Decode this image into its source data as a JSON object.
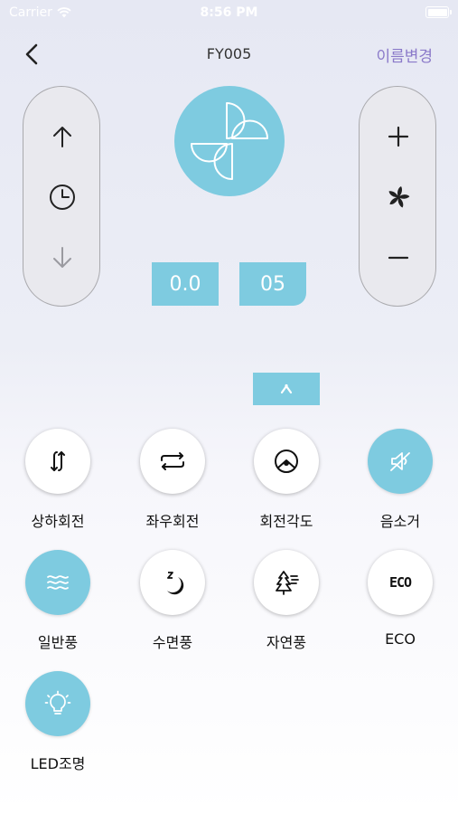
{
  "status_bar": {
    "carrier": "Carrier",
    "time": "8:56 PM"
  },
  "nav": {
    "title": "FY005",
    "rename_label": "이름변경"
  },
  "display": {
    "timer_value": "0.0",
    "speed_value": "05"
  },
  "colors": {
    "accent": "#7ecbe0",
    "rename": "#8a79c9"
  },
  "left_controls": [
    "arrow-up-icon",
    "timer-icon",
    "arrow-down-icon"
  ],
  "right_controls": [
    "plus-icon",
    "fan-icon",
    "minus-icon"
  ],
  "functions": [
    {
      "label": "상하회전",
      "icon": "vertical-swing-icon",
      "active": false
    },
    {
      "label": "좌우회전",
      "icon": "horizontal-swing-icon",
      "active": false
    },
    {
      "label": "회전각도",
      "icon": "rotation-angle-icon",
      "active": false
    },
    {
      "label": "음소거",
      "icon": "mute-icon",
      "active": true
    },
    {
      "label": "일반풍",
      "icon": "normal-wind-icon",
      "active": true
    },
    {
      "label": "수면풍",
      "icon": "sleep-wind-icon",
      "active": false
    },
    {
      "label": "자연풍",
      "icon": "natural-wind-icon",
      "active": false
    },
    {
      "label": "ECO",
      "icon": "eco-icon",
      "icon_text": "ECO",
      "active": false
    },
    {
      "label": "LED조명",
      "icon": "led-light-icon",
      "active": true
    }
  ]
}
